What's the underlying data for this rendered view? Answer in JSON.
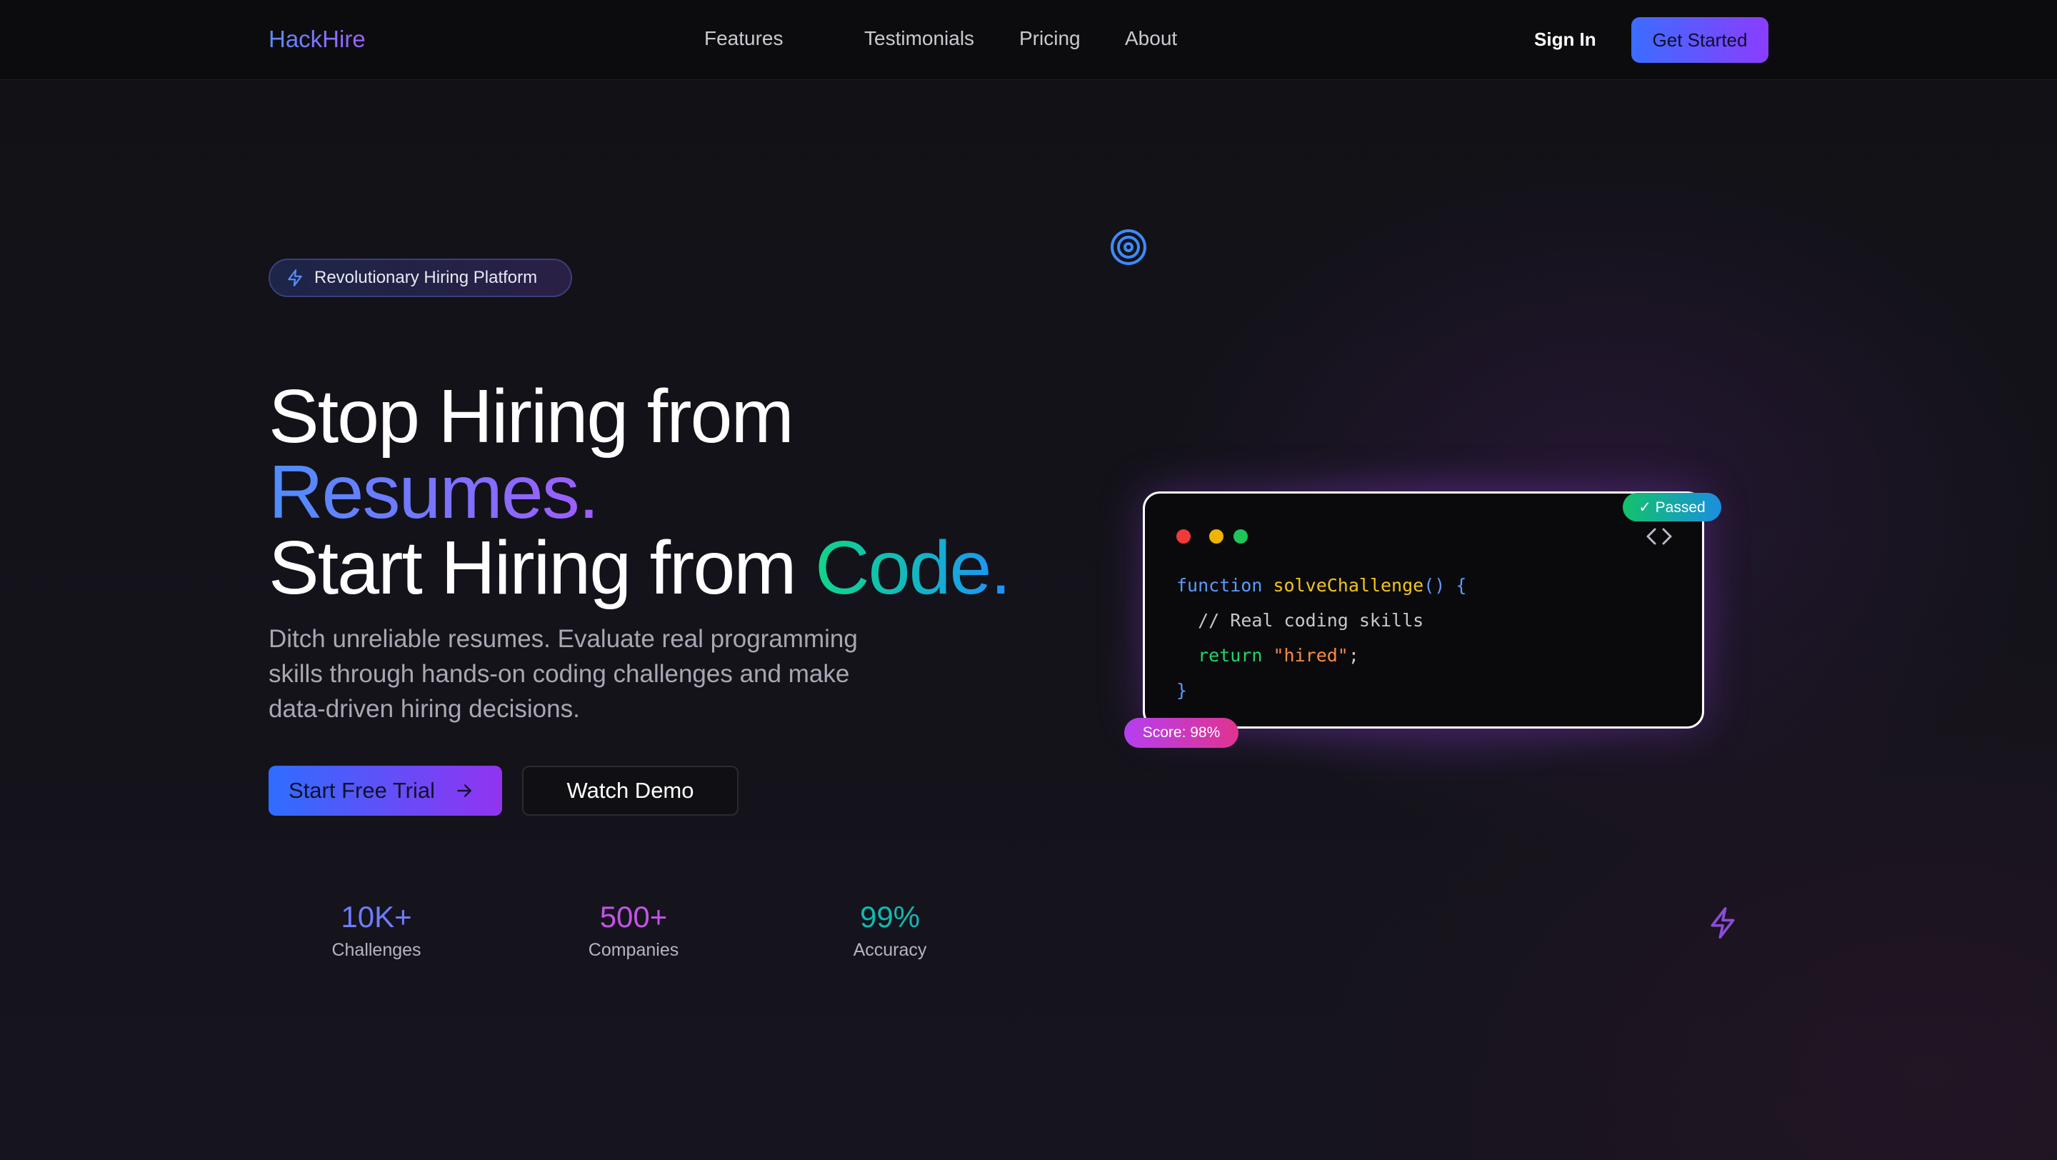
{
  "nav": {
    "logo": "HackHire",
    "links": [
      "Features",
      "Testimonials",
      "Pricing",
      "About"
    ],
    "sign_in": "Sign In",
    "get_started": "Get Started"
  },
  "hero": {
    "badge": "Revolutionary Hiring Platform",
    "line1": "Stop Hiring from",
    "line2": "Resumes.",
    "line3_prefix": "Start Hiring from ",
    "line3_highlight": "Code.",
    "subtitle": "Ditch unreliable resumes. Evaluate real programming skills through hands-on coding challenges and make data-driven hiring decisions.",
    "primary_button": "Start Free Trial",
    "secondary_button": "Watch Demo"
  },
  "stats": [
    {
      "value": "10K+",
      "label": "Challenges",
      "color": "#6f7cff"
    },
    {
      "value": "500+",
      "label": "Companies",
      "color": "#c354e6"
    },
    {
      "value": "99%",
      "label": "Accuracy",
      "color": "#12b8b0"
    }
  ],
  "code_card": {
    "line1_keyword": "function",
    "line1_name": "solveChallenge",
    "line1_rest": "() {",
    "line2": "// Real coding skills",
    "line3_keyword": "return",
    "line3_string": "\"hired\"",
    "line3_end": ";",
    "line4": "}",
    "passed_tag": "✓ Passed",
    "score_tag": "Score: 98%"
  },
  "colors": {
    "accent_blue": "#3b6dff",
    "accent_purple": "#8b3dff",
    "code_keyword": "#5b9bff",
    "code_function": "#f5c518",
    "code_comment": "#c8c8c8",
    "code_return": "#22d36a",
    "code_string": "#ff8a3d"
  },
  "icons": [
    "lightning-icon",
    "target-icon",
    "arrow-right-icon",
    "code-brackets-icon",
    "bolt-icon"
  ]
}
